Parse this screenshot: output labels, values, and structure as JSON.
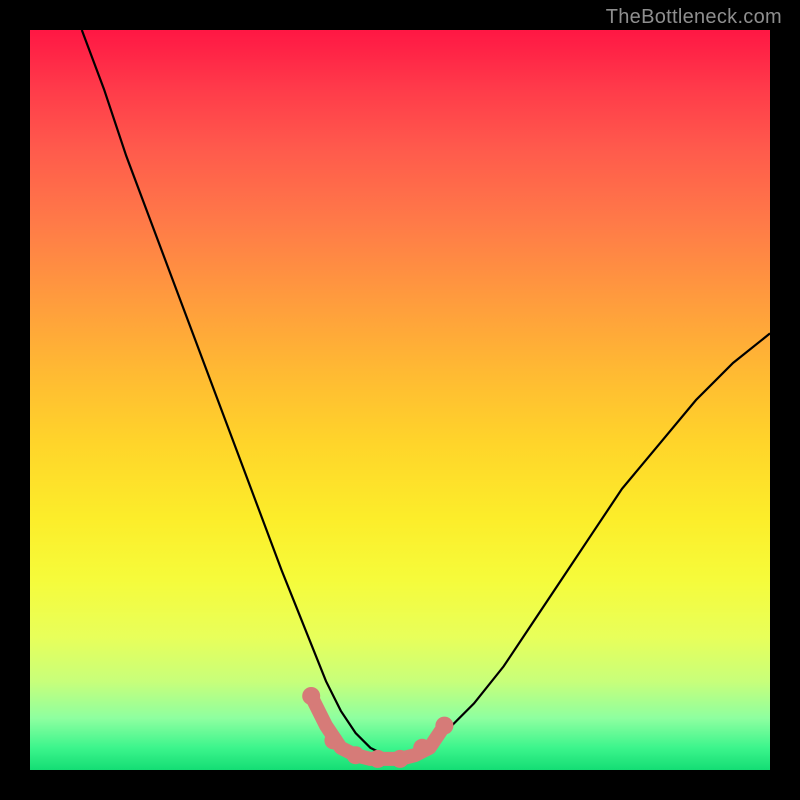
{
  "watermark": "TheBottleneck.com",
  "chart_data": {
    "type": "line",
    "title": "",
    "xlabel": "",
    "ylabel": "",
    "xlim": [
      0,
      100
    ],
    "ylim": [
      0,
      100
    ],
    "grid": false,
    "legend": false,
    "annotations": [],
    "series": [
      {
        "name": "bottleneck-curve-main",
        "color": "#000000",
        "x": [
          7,
          10,
          13,
          16,
          19,
          22,
          25,
          28,
          31,
          34,
          36,
          38,
          40,
          42,
          44,
          46,
          48,
          50,
          53,
          56,
          60,
          64,
          68,
          72,
          76,
          80,
          85,
          90,
          95,
          100
        ],
        "values": [
          100,
          92,
          83,
          75,
          67,
          59,
          51,
          43,
          35,
          27,
          22,
          17,
          12,
          8,
          5,
          3,
          2,
          2,
          3,
          5,
          9,
          14,
          20,
          26,
          32,
          38,
          44,
          50,
          55,
          59
        ]
      },
      {
        "name": "flat-band-highlight",
        "color": "#d67b78",
        "x": [
          38,
          40,
          42,
          44,
          46,
          48,
          50,
          52,
          54,
          56
        ],
        "values": [
          10,
          6,
          3,
          2,
          1.5,
          1.5,
          1.5,
          2,
          3,
          6
        ]
      }
    ],
    "markers": {
      "name": "flat-band-markers",
      "color": "#d67b78",
      "x": [
        38,
        41,
        44,
        47,
        50,
        53,
        56
      ],
      "values": [
        10,
        4,
        2,
        1.5,
        1.5,
        3,
        6
      ]
    }
  }
}
